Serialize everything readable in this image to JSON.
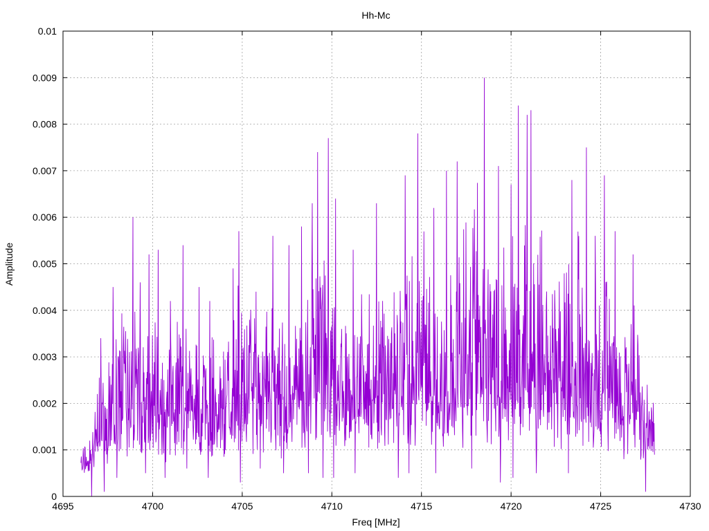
{
  "chart_data": {
    "type": "line",
    "title": "Hh-Mc",
    "xlabel": "Freq [MHz]",
    "ylabel": "Amplitude",
    "xlim": [
      4695,
      4730
    ],
    "ylim": [
      0,
      0.01
    ],
    "xticks": [
      4695,
      4700,
      4705,
      4710,
      4715,
      4720,
      4725,
      4730
    ],
    "xtick_labels": [
      "4695",
      "4700",
      "4705",
      "4710",
      "4715",
      "4720",
      "4725",
      "4730"
    ],
    "yticks": [
      0,
      0.001,
      0.002,
      0.003,
      0.004,
      0.005,
      0.006,
      0.007,
      0.008,
      0.009,
      0.01
    ],
    "ytick_labels": [
      "0",
      "0.001",
      "0.002",
      "0.003",
      "0.004",
      "0.005",
      "0.006",
      "0.007",
      "0.008",
      "0.009",
      "0.01"
    ],
    "grid": true,
    "series": [
      {
        "color": "#9400d3",
        "x_range": [
          4696.0,
          4728.0
        ],
        "peaks": [
          [
            4696.5,
            0.0012
          ],
          [
            4697.1,
            0.0034
          ],
          [
            4697.8,
            0.0045
          ],
          [
            4698.9,
            0.006
          ],
          [
            4699.3,
            0.0046
          ],
          [
            4699.8,
            0.0052
          ],
          [
            4700.3,
            0.0053
          ],
          [
            4701.0,
            0.0042
          ],
          [
            4701.7,
            0.0054
          ],
          [
            4702.6,
            0.0045
          ],
          [
            4703.2,
            0.0042
          ],
          [
            4704.5,
            0.0049
          ],
          [
            4704.8,
            0.0057
          ],
          [
            4706.7,
            0.0056
          ],
          [
            4707.6,
            0.0054
          ],
          [
            4708.3,
            0.0058
          ],
          [
            4708.9,
            0.0063
          ],
          [
            4709.2,
            0.0074
          ],
          [
            4709.8,
            0.0077
          ],
          [
            4710.2,
            0.0064
          ],
          [
            4711.2,
            0.0053
          ],
          [
            4712.5,
            0.0063
          ],
          [
            4714.1,
            0.0069
          ],
          [
            4714.8,
            0.0078
          ],
          [
            4715.7,
            0.0062
          ],
          [
            4716.4,
            0.007
          ],
          [
            4717.0,
            0.0072
          ],
          [
            4718.5,
            0.009
          ],
          [
            4719.3,
            0.0071
          ],
          [
            4720.0,
            0.0067
          ],
          [
            4720.4,
            0.0084
          ],
          [
            4720.9,
            0.0082
          ],
          [
            4721.1,
            0.0083
          ],
          [
            4723.4,
            0.0068
          ],
          [
            4724.2,
            0.0075
          ],
          [
            4724.7,
            0.0056
          ],
          [
            4725.2,
            0.0069
          ],
          [
            4725.8,
            0.0057
          ],
          [
            4726.8,
            0.0052
          ],
          [
            4727.6,
            0.0024
          ]
        ],
        "troughs": [
          [
            4696.6,
            0.0
          ],
          [
            4697.3,
            0.0001
          ],
          [
            4698.0,
            0.0004
          ],
          [
            4699.6,
            0.0005
          ],
          [
            4700.7,
            0.0004
          ],
          [
            4701.9,
            0.0006
          ],
          [
            4703.1,
            0.0004
          ],
          [
            4704.9,
            0.0003
          ],
          [
            4706.0,
            0.0006
          ],
          [
            4707.3,
            0.0005
          ],
          [
            4708.7,
            0.0005
          ],
          [
            4709.5,
            0.0004
          ],
          [
            4710.1,
            0.0004
          ],
          [
            4711.3,
            0.0005
          ],
          [
            4713.7,
            0.0004
          ],
          [
            4714.3,
            0.0005
          ],
          [
            4715.8,
            0.0005
          ],
          [
            4717.8,
            0.0006
          ],
          [
            4719.4,
            0.0003
          ],
          [
            4720.1,
            0.0004
          ],
          [
            4721.4,
            0.0005
          ],
          [
            4723.2,
            0.0005
          ],
          [
            4726.3,
            0.0008
          ],
          [
            4727.5,
            0.0001
          ]
        ]
      }
    ]
  }
}
